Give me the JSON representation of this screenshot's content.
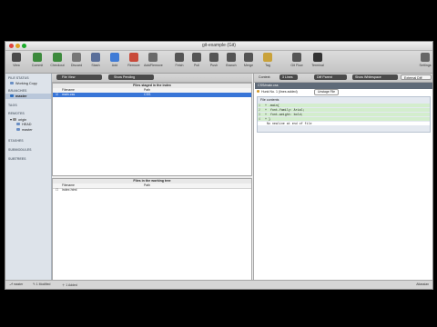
{
  "app": {
    "title": "git-example (Git)"
  },
  "toolbar": {
    "buttons": [
      {
        "label": "View",
        "icon": "view-icon",
        "color": "#4a4a4a"
      },
      {
        "label": "Commit",
        "icon": "commit-icon",
        "color": "#3c8a3c"
      },
      {
        "label": "Checkout",
        "icon": "checkout-icon",
        "color": "#3c8a3c"
      },
      {
        "label": "Discard",
        "icon": "discard-icon",
        "color": "#777777"
      },
      {
        "label": "Stash",
        "icon": "stash-icon",
        "color": "#5a6f9a"
      },
      {
        "label": "Add",
        "icon": "add-icon",
        "color": "#3f7bd6"
      },
      {
        "label": "Remove",
        "icon": "remove-icon",
        "color": "#c94a3a"
      },
      {
        "label": "Add/Remove",
        "icon": "add-remove-icon",
        "color": "#6a6a6a"
      },
      {
        "label": "Fetch",
        "icon": "fetch-icon",
        "color": "#555555"
      },
      {
        "label": "Pull",
        "icon": "pull-icon",
        "color": "#555555"
      },
      {
        "label": "Push",
        "icon": "push-icon",
        "color": "#555555"
      },
      {
        "label": "Branch",
        "icon": "branch-icon",
        "color": "#555555"
      },
      {
        "label": "Merge",
        "icon": "merge-icon",
        "color": "#555555"
      },
      {
        "label": "Tag",
        "icon": "tag-icon",
        "color": "#c9a23a"
      },
      {
        "label": "Git Flow",
        "icon": "git-flow-icon",
        "color": "#555555"
      },
      {
        "label": "Terminal",
        "icon": "terminal-icon",
        "color": "#333333"
      },
      {
        "label": "Settings",
        "icon": "settings-icon",
        "color": "#666666"
      }
    ]
  },
  "sidebar": {
    "sections": {
      "file_status": "FILE STATUS",
      "branches": "BRANCHES",
      "tags": "TAGS",
      "remotes": "REMOTES",
      "stashes": "STASHES",
      "submodules": "SUBMODULES",
      "subtrees": "SUBTREES"
    },
    "items": {
      "working_copy": "Working Copy",
      "master": "master",
      "origin": "origin",
      "head": "HEAD",
      "origin_master": "master"
    }
  },
  "filterbar": {
    "file_view": "File View",
    "show_pending": "Show Pending"
  },
  "staged": {
    "title": "Files staged in the index",
    "col_filename": "Filename",
    "col_path": "Path",
    "rows": [
      {
        "filename": "main.css",
        "path": "CSS"
      }
    ]
  },
  "working": {
    "title": "Files in the working tree",
    "col_filename": "Filename",
    "col_path": "Path",
    "rows": [
      {
        "filename": "index.html",
        "path": ""
      }
    ]
  },
  "diffbar": {
    "context_label": "Context:",
    "context_value": "3 Lines",
    "diff_parent": "Diff Parent",
    "show_whitespace": "Show Whitespace",
    "external_diff": "External Diff"
  },
  "diff": {
    "file_header": "CSS/main.css",
    "hunk_info": "Hunk No. 1 (lines added)",
    "unstage_label": "Unstage File",
    "file_contents_label": "File contents",
    "lines": [
      {
        "num": "1",
        "sign": "+",
        "text": ".main{",
        "type": "add"
      },
      {
        "num": "2",
        "sign": "+",
        "text": "  font-family: Arial;",
        "type": "add"
      },
      {
        "num": "3",
        "sign": "+",
        "text": "  font-weight: bold;",
        "type": "add"
      },
      {
        "num": "4",
        "sign": "+",
        "text": "}",
        "type": "add"
      },
      {
        "num": "",
        "sign": "",
        "text": "No newline at end of file",
        "type": "note"
      }
    ]
  },
  "statusbar": {
    "branch": "master",
    "modified": "1 Modified",
    "added": "1 Added",
    "right": "Atlassian"
  }
}
